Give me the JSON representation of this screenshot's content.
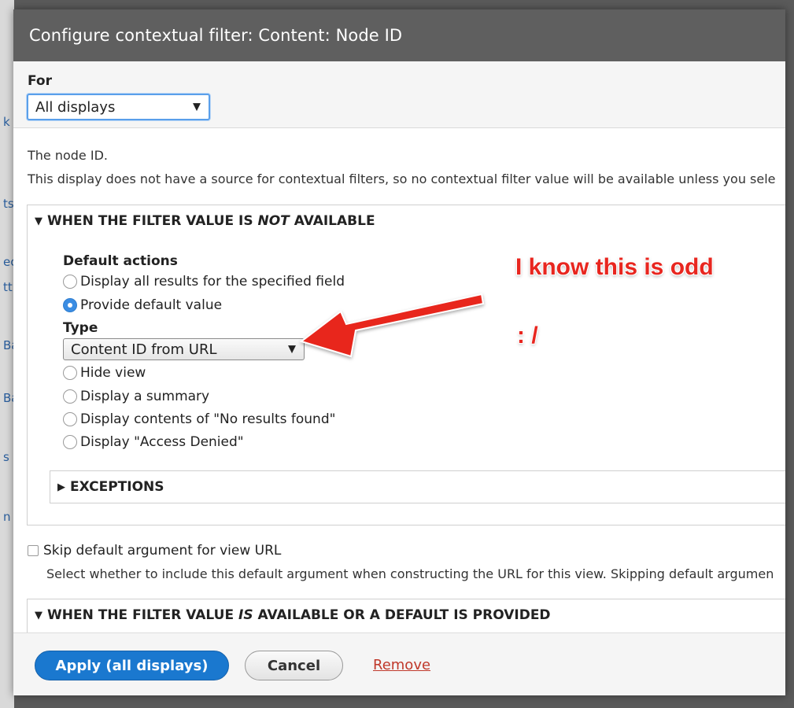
{
  "dialog": {
    "title": "Configure contextual filter: Content: Node ID"
  },
  "for": {
    "label": "For",
    "selected": "All displays"
  },
  "description": {
    "line1": "The node ID.",
    "line2": "This display does not have a source for contextual filters, so no contextual filter value will be available unless you sele"
  },
  "not_available": {
    "legend_prefix": "WHEN THE FILTER VALUE IS",
    "legend_emph": "NOT",
    "legend_suffix": "AVAILABLE",
    "default_actions_label": "Default actions",
    "options": [
      "Display all results for the specified field",
      "Provide default value",
      "Hide view",
      "Display a summary",
      "Display contents of \"No results found\"",
      "Display \"Access Denied\""
    ],
    "selected_option": "Provide default value",
    "type_label": "Type",
    "type_selected": "Content ID from URL",
    "exceptions_label": "EXCEPTIONS"
  },
  "skip": {
    "label": "Skip default argument for view URL",
    "description": "Select whether to include this default argument when constructing the URL for this view. Skipping default argumen",
    "checked": false
  },
  "is_available": {
    "legend_prefix": "WHEN THE FILTER VALUE",
    "legend_emph": "IS",
    "legend_suffix": "AVAILABLE OR A DEFAULT IS PROVIDED"
  },
  "footer": {
    "apply_label": "Apply (all displays)",
    "cancel_label": "Cancel",
    "remove_label": "Remove"
  },
  "annotation": {
    "line1": "I know this is odd",
    "line2": ": /",
    "color": "#e8261f"
  },
  "background_fragments": [
    "k",
    "ts",
    "ec",
    "tt",
    "Ba",
    "Ba",
    "s",
    "n"
  ],
  "colors": {
    "titlebar": "#5f5f5f",
    "primary": "#1a78cf",
    "radio_checked": "#3b8de3",
    "remove_link": "#c0392b"
  }
}
